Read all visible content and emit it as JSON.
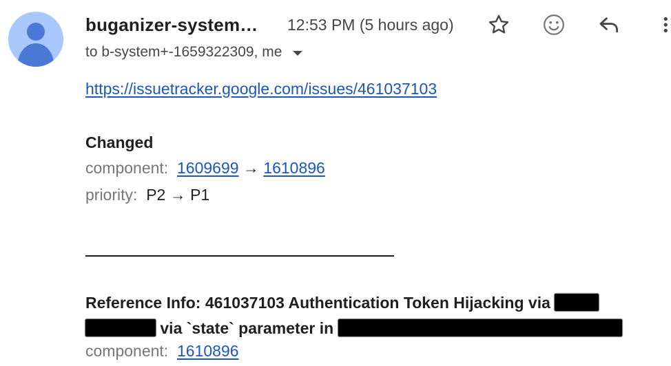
{
  "header": {
    "sender": "buganizer-system…",
    "timestamp": "12:53 PM (5 hours ago)",
    "recipients": "to b-system+-1659322309, me"
  },
  "icons": {
    "avatar": "person-avatar-icon",
    "recipients_toggle": "chevron-down-icon",
    "star": "star-outline-icon",
    "emoji": "emoji-reaction-icon",
    "reply": "reply-icon",
    "more": "more-vertical-icon"
  },
  "body": {
    "issue_url": "https://issuetracker.google.com/issues/461037103",
    "changed_heading": "Changed",
    "component_label": "component:",
    "component_from": "1609699",
    "arrow": "→",
    "component_to": "1610896",
    "priority_label": "priority:",
    "priority_change": "P2 → P1",
    "reference_prefix": "Reference Info: 461037103 Authentication Token Hijacking via",
    "reference_via": "via `state` parameter in",
    "ref_component_label": "component:",
    "ref_component_value": "1610896"
  },
  "colors": {
    "avatar_bg": "#a8c7fa",
    "avatar_fg": "#4a78d6",
    "link": "#1a55c2",
    "label_gray": "#747775",
    "redaction": "#000000"
  }
}
